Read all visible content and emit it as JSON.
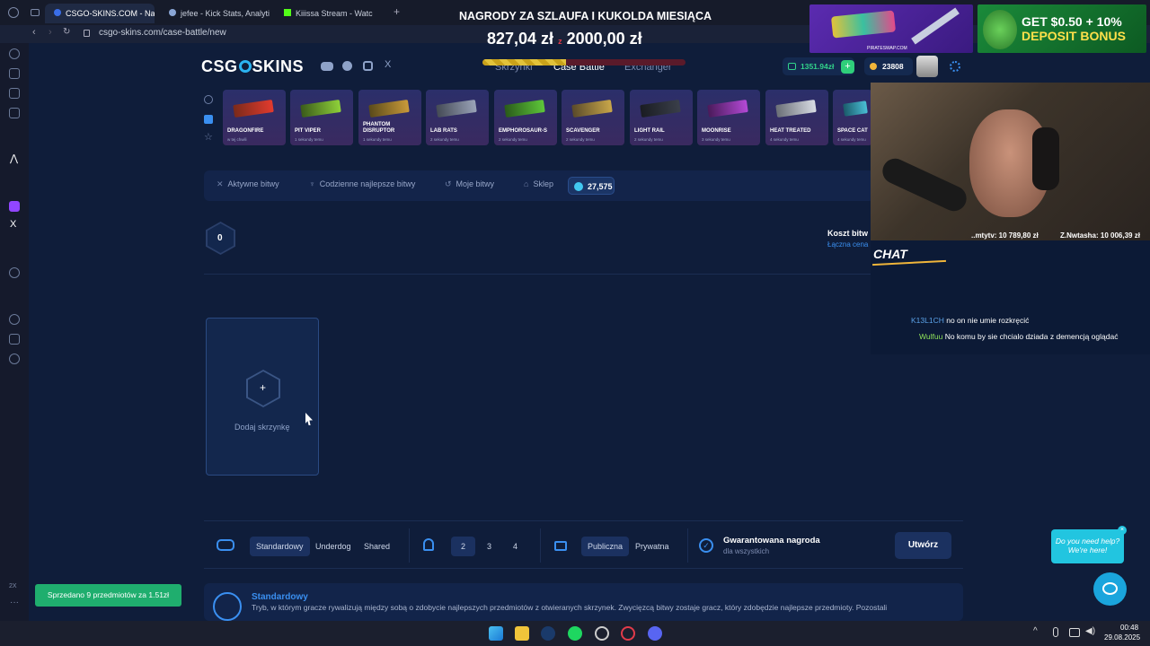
{
  "browser": {
    "tabs": [
      "CSGO-SKINS.COM - Naj",
      "jefee - Kick Stats, Analyti",
      "Kiiissa Stream - Watc"
    ],
    "url": "csgo-skins.com/case-battle/new"
  },
  "overlay": {
    "title": "NAGRODY ZA SZLAUFA I KUKOLDA MIESIĄCA",
    "progress": "827,04 zł",
    "progress_sep": "z",
    "goal": "2000,00 zł",
    "progress_fraction": 0.41,
    "ad_site": "PIRATESWAP.COM",
    "ad_text_1": "GET $0.50 + 10%",
    "ad_text_2": "DEPOSIT BONUS"
  },
  "header": {
    "logo_left": "CSG",
    "logo_right": "SKINS",
    "nav": [
      "Skrzynki",
      "Case Battle",
      "Exchanger"
    ],
    "balance": "1351.94zł",
    "coins": "23808"
  },
  "cases": [
    {
      "name": "DRAGONFIRE",
      "sub": "w tej chwili",
      "color": "#e23b2e"
    },
    {
      "name": "PIT VIPER",
      "sub": "1 sekundy temu",
      "color": "#8fd13a"
    },
    {
      "name": "PHANTOM DISRUPTOR",
      "sub": "1 sekundy temu",
      "color": "#c99a3a"
    },
    {
      "name": "LAB RATS",
      "sub": "2 sekundy temu",
      "color": "#9aa3b8"
    },
    {
      "name": "EMPHOROSAUR-S",
      "sub": "2 sekundy temu",
      "color": "#5ec73a"
    },
    {
      "name": "SCAVENGER",
      "sub": "2 sekundy temu",
      "color": "#c9a74a"
    },
    {
      "name": "LIGHT RAIL",
      "sub": "2 sekundy temu",
      "color": "#3a3f4a"
    },
    {
      "name": "MOONRISE",
      "sub": "3 sekundy temu",
      "color": "#b44ad6"
    },
    {
      "name": "HEAT TREATED",
      "sub": "4 sekundy temu",
      "color": "#b8bcc4"
    },
    {
      "name": "SPACE CAT",
      "sub": "4 sekundy temu",
      "color": "#4ac0d6"
    }
  ],
  "subnav": {
    "tabs": [
      "Aktywne bitwy",
      "Codzienne najlepsze bitwy",
      "Moje bitwy",
      "Sklep"
    ],
    "counter": "27,575"
  },
  "battle": {
    "case_count": "0",
    "cost_label": "Koszt bitw",
    "total_label": "Łączna cena skrzynek",
    "add_case": "Dodaj skrzynkę",
    "add_symbol": "+"
  },
  "options": {
    "modes": [
      "Standardowy",
      "Underdog",
      "Shared"
    ],
    "players": [
      "2",
      "3",
      "4"
    ],
    "visibility": [
      "Publiczna",
      "Prywatna"
    ],
    "guarantee_title": "Gwarantowana nagroda",
    "guarantee_sub": "dla wszystkich",
    "create": "Utwórz"
  },
  "description": {
    "title": "Standardowy",
    "text": "Tryb, w którym gracze rywalizują między sobą o zdobycie najlepszych przedmiotów z otwieranych skrzynek. Zwycięzcą bitwy zostaje gracz, który zdobędzie najlepsze przedmioty. Pozostali"
  },
  "stream": {
    "ticker_1": "..mtytv: 10 789,80 zł",
    "ticker_2": "Z.Nwtasha: 10 006,39 zł",
    "chat_label": "CHAT",
    "messages": [
      {
        "user": "K13L1CH",
        "text": "no on nie umie rozkręcić",
        "color": "#5aa0e6"
      },
      {
        "user": "Wulfuu",
        "text": "No komu by sie chcialo dziada z demencją oglądać",
        "color": "#8fe35a"
      }
    ]
  },
  "toast": "Sprzedano 9 przedmiotów za 1.51zł",
  "help": {
    "line1": "Do you need help?",
    "line2": "We're here!"
  },
  "taskbar": {
    "time": "00:48",
    "date": "29.08.2025"
  },
  "left_rail_badge": "2X"
}
